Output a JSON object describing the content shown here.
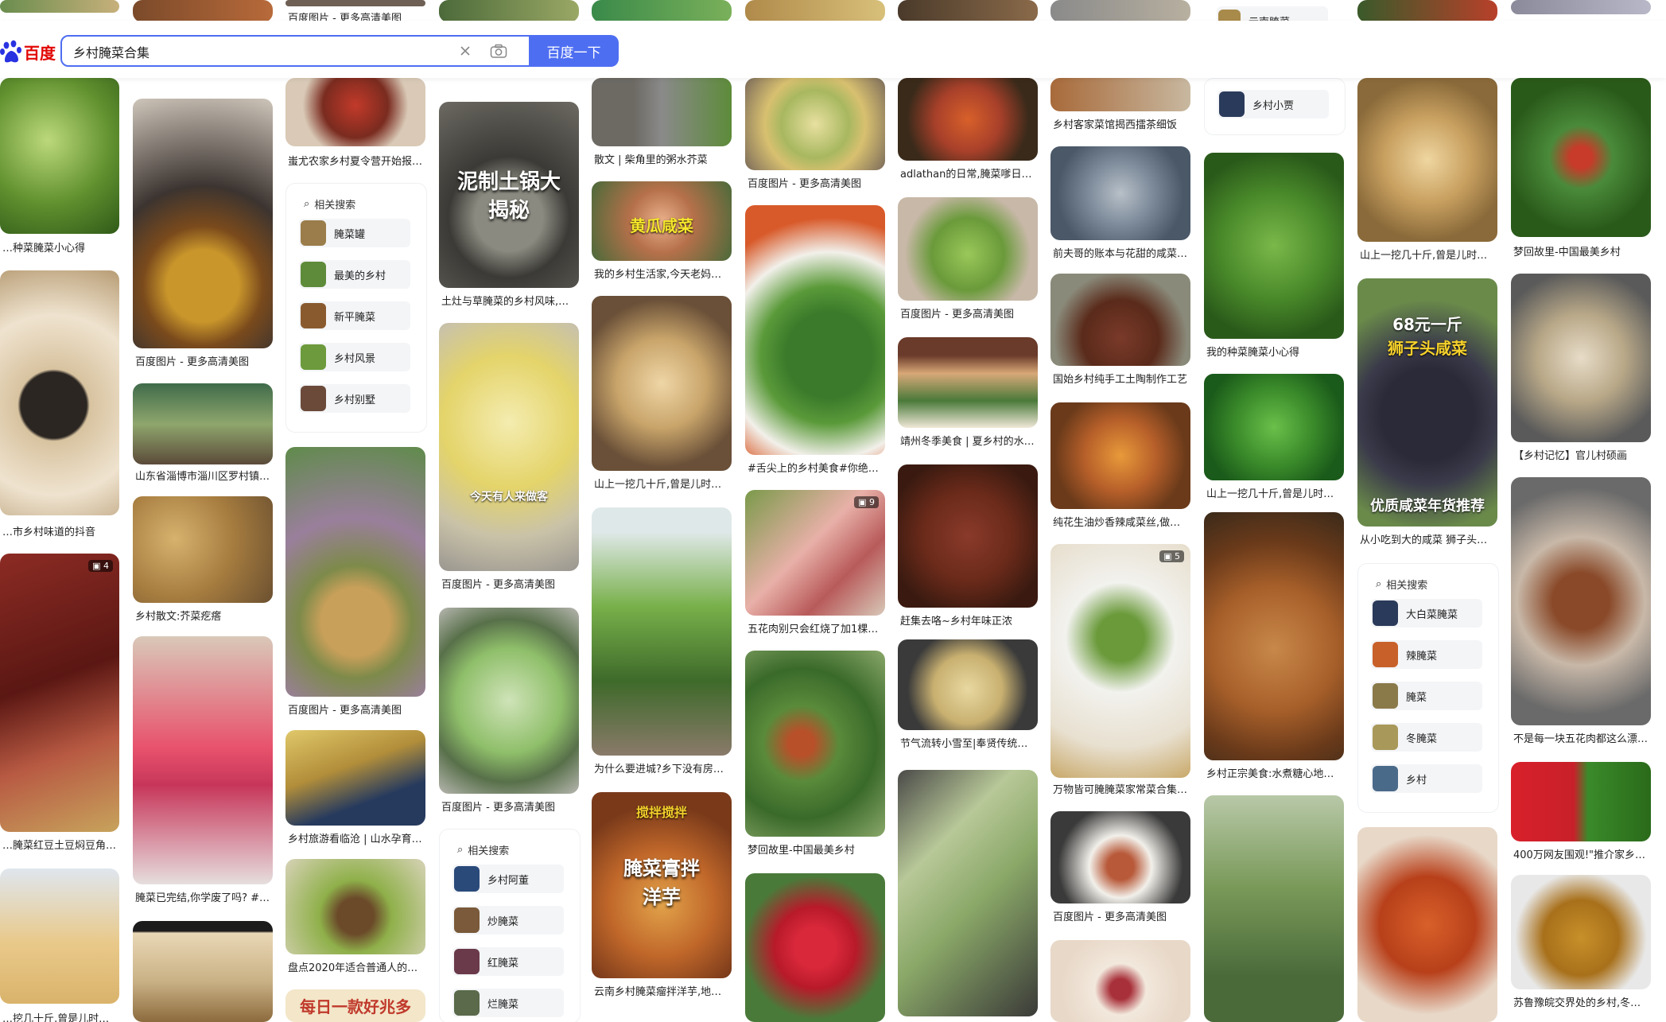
{
  "header": {
    "logo_text": "百度",
    "search_value": "乡村腌菜合集",
    "search_button": "百度一下",
    "clear_icon": "close-icon",
    "camera_icon": "camera-icon"
  },
  "captions": {
    "c0a": "百度图片 - 更多高清美图",
    "c0b": "…种菜腌菜小心得",
    "c0c": "…市乡村味道的抖音",
    "c0d": "…腌菜红豆土豆焖豆角真…",
    "c0e": "…挖几十斤,曾是儿时…",
    "c1a": "百度图片 - 更多高清美图",
    "c1b": "山东省淄博市淄川区罗村镇…",
    "c1c": "乡村散文:芥菜疙瘩",
    "c1d": "腌菜已完结,你学废了吗? #…",
    "c2a": "蚩尤农家乡村夏令营开始报…",
    "c2b": "百度图片 - 更多高清美图",
    "c2c": "乡村旅游看临沧 | 山水孕育…",
    "c2d": "盘点2020年适合普通人的…",
    "c3a": "土灶与草腌菜的乡村风味,…",
    "c3b": "百度图片 - 更多高清美图",
    "c3c": "百度图片 - 更多高清美图",
    "c4a": "散文 | 柴角里的粥水芥菜",
    "c4b": "我的乡村生活家,今天老妈…",
    "c4c": "山上一挖几十斤,曾是儿时…",
    "c4d": "为什么要进城?乡下没有房…",
    "c4e": "云南乡村腌菜瘤拌洋芋,地…",
    "c5a": "百度图片 - 更多高清美图",
    "c5b": "#舌尖上的乡村美食#你绝对…",
    "c5c": "五花肉别只会红烧了加1棵…",
    "c5d": "梦回故里-中国最美乡村",
    "c6a": "adlathan的日常,腌菜嗲日常…",
    "c6b": "百度图片 - 更多高清美图",
    "c6c": "靖州冬季美食 | 夏乡村的水…",
    "c6d": "赶集去咯~乡村年味正浓",
    "c6e": "节气流转小雪至|奉贤传统…",
    "c7a": "乡村客家菜馆揭西擂茶细饭",
    "c7b": "前夫哥的账本与花甜的咸菜…",
    "c7c": "国始乡村纯手工土陶制作工艺",
    "c7d": "纯花生油炒香辣咸菜丝,做…",
    "c7e": "万物皆可腌腌菜家常菜合集…",
    "c7f": "百度图片 - 更多高清美图",
    "c8a": "我的种菜腌菜小心得",
    "c8b": "山上一挖几十斤,曾是儿时…",
    "c8c": "乡村正宗美食:水煮糖心地…",
    "c9a": "山上一挖几十斤,曾是儿时…",
    "c9b": "从小吃到大的咸菜 狮子头…",
    "c10a": "梦回故里-中国最美乡村",
    "c10b": "【乡村记忆】官儿村硕画",
    "c10c": "不是每一块五花肉都这么漂…",
    "c10d": "400万网友围观!\"推介家乡…",
    "c10e": "苏鲁豫皖交界处的乡村,冬…"
  },
  "overlays": {
    "o1": "泥制土锅大",
    "o2": "揭秘",
    "o3": "黄瓜咸菜",
    "o4": "今天有人来做客",
    "o5": "68元一斤",
    "o6": "狮子头咸菜",
    "o7": "优质咸菜年货推荐",
    "o8": "搅拌搅拌",
    "o9": "腌菜膏拌",
    "o10": "洋芋",
    "o11": "每日一款好兆多"
  },
  "counts": {
    "n1": "4",
    "n2": "9",
    "n3": "5"
  },
  "related": {
    "title": "相关搜索",
    "r1": [
      "腌菜罐",
      "最美的乡村",
      "新平腌菜",
      "乡村风景",
      "乡村别墅"
    ],
    "r2": [
      "乡村阿董",
      "炒腌菜",
      "红腌菜",
      "烂腌菜"
    ],
    "r3": [
      "大白菜腌菜",
      "辣腌菜",
      "腌菜",
      "冬腌菜",
      "乡村"
    ]
  },
  "tags": {
    "t1": "云南腌菜",
    "t2": "乡村小贾"
  }
}
